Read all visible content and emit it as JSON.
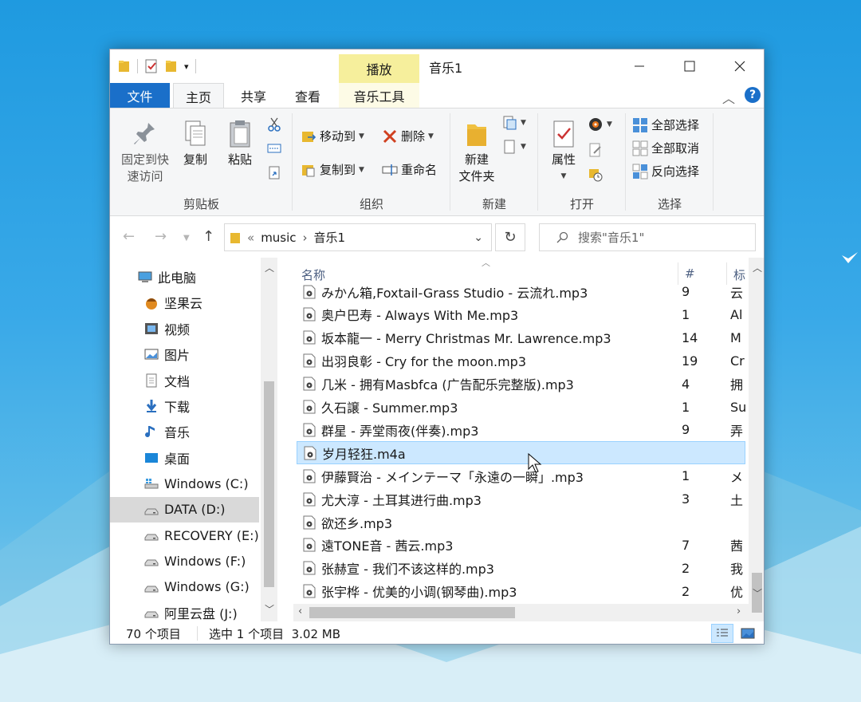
{
  "window": {
    "title": "音乐1",
    "context_tab_group": "播放",
    "context_tab": "音乐工具"
  },
  "tabs": {
    "file": "文件",
    "home": "主页",
    "share": "共享",
    "view": "查看"
  },
  "ribbon": {
    "clipboard": {
      "label": "剪贴板",
      "pin": "固定到快速访问",
      "pin_line1": "固定到快",
      "pin_line2": "速访问",
      "copy": "复制",
      "paste": "粘贴"
    },
    "organize": {
      "label": "组织",
      "move_to": "移动到",
      "copy_to": "复制到",
      "delete": "删除",
      "rename": "重命名"
    },
    "new": {
      "label": "新建",
      "new_folder_line1": "新建",
      "new_folder_line2": "文件夹"
    },
    "open": {
      "label": "打开",
      "properties": "属性"
    },
    "select": {
      "label": "选择",
      "select_all": "全部选择",
      "select_none": "全部取消",
      "invert": "反向选择"
    }
  },
  "address": {
    "prefix": "«",
    "segments": [
      "music",
      "音乐1"
    ],
    "separator": "›"
  },
  "search": {
    "placeholder": "搜索\"音乐1\""
  },
  "nav": [
    {
      "label": "此电脑",
      "icon": "computer-icon"
    },
    {
      "label": "坚果云",
      "icon": "nutstore-icon"
    },
    {
      "label": "视频",
      "icon": "video-folder-icon"
    },
    {
      "label": "图片",
      "icon": "pictures-folder-icon"
    },
    {
      "label": "文档",
      "icon": "documents-folder-icon"
    },
    {
      "label": "下载",
      "icon": "downloads-icon"
    },
    {
      "label": "音乐",
      "icon": "music-note-icon"
    },
    {
      "label": "桌面",
      "icon": "desktop-icon"
    },
    {
      "label": "Windows (C:)",
      "icon": "system-drive-icon"
    },
    {
      "label": "DATA (D:)",
      "icon": "drive-icon",
      "selected": true
    },
    {
      "label": "RECOVERY (E:)",
      "icon": "drive-icon"
    },
    {
      "label": "Windows (F:)",
      "icon": "drive-icon"
    },
    {
      "label": "Windows (G:)",
      "icon": "drive-icon"
    },
    {
      "label": "阿里云盘 (J:)",
      "icon": "drive-icon"
    }
  ],
  "columns": {
    "name": "名称",
    "number": "#",
    "artist": "标"
  },
  "files": [
    {
      "name": "みかん箱,Foxtail-Grass Studio - 云流れ.mp3",
      "num": "9",
      "art": "云"
    },
    {
      "name": "奥户巴寿 - Always With Me.mp3",
      "num": "1",
      "art": "Al"
    },
    {
      "name": "坂本龍一 - Merry Christmas Mr. Lawrence.mp3",
      "num": "14",
      "art": "M"
    },
    {
      "name": "出羽良彰 - Cry for the moon.mp3",
      "num": "19",
      "art": "Cr"
    },
    {
      "name": "几米 - 拥有Masbfca (广告配乐完整版).mp3",
      "num": "4",
      "art": "拥"
    },
    {
      "name": "久石譲 - Summer.mp3",
      "num": "1",
      "art": "Su"
    },
    {
      "name": "群星 - 弄堂雨夜(伴奏).mp3",
      "num": "9",
      "art": "弄"
    },
    {
      "name": "岁月轻狂.m4a",
      "num": "",
      "art": "",
      "selected": true
    },
    {
      "name": "伊藤賢治 - メインテーマ「永遠の一瞬」.mp3",
      "num": "1",
      "art": "メ"
    },
    {
      "name": "尤大淳 - 土耳其进行曲.mp3",
      "num": "3",
      "art": "土"
    },
    {
      "name": "欲还乡.mp3",
      "num": "",
      "art": ""
    },
    {
      "name": "遠TONE音 - 茜云.mp3",
      "num": "7",
      "art": "茜"
    },
    {
      "name": "张赫宣 - 我们不该这样的.mp3",
      "num": "2",
      "art": "我"
    },
    {
      "name": "张宇桦 - 优美的小调(钢琴曲).mp3",
      "num": "2",
      "art": "优"
    }
  ],
  "status": {
    "count": "70 个项目",
    "selected": "选中 1 个项目  3.02 MB"
  }
}
